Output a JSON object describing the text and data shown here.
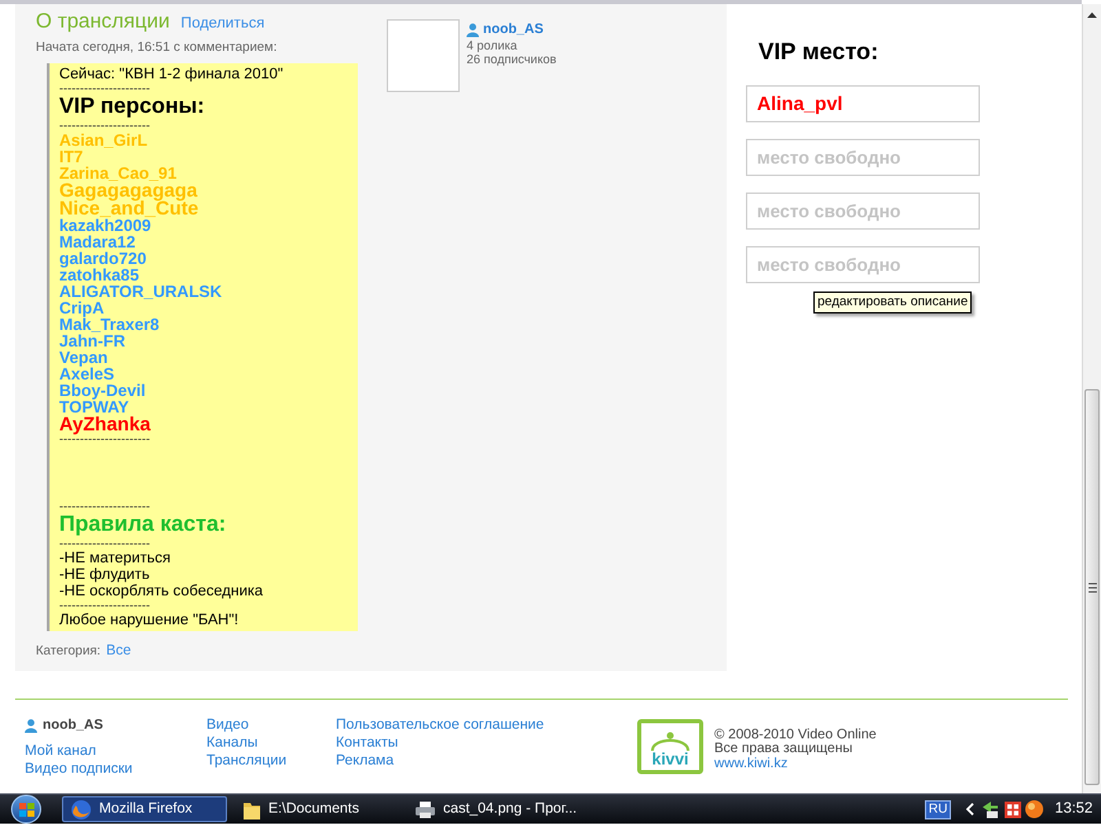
{
  "header": {
    "title": "О трансляции",
    "share_link": "Поделиться",
    "started": "Начата сегодня, 16:51 с комментарием:"
  },
  "comment": {
    "lines": [
      {
        "kind": "text",
        "text": "Сейчас: \"КВН 1-2 финала 2010\""
      },
      {
        "kind": "rule",
        "text": "----------------------"
      },
      {
        "kind": "heading",
        "text": "VIP персоны:",
        "color": "#000000"
      },
      {
        "kind": "rule",
        "text": "----------------------"
      },
      {
        "kind": "name",
        "text": "Asian_GirL",
        "color": "#ffc000"
      },
      {
        "kind": "name",
        "text": "IT7",
        "color": "#ffc000"
      },
      {
        "kind": "name",
        "text": "Zarina_Cao_91",
        "color": "#ffc000"
      },
      {
        "kind": "bigname",
        "text": "Gagagagagaga",
        "color": "#ffc000"
      },
      {
        "kind": "bigname",
        "text": "Nice_and_Cute",
        "color": "#ffc000"
      },
      {
        "kind": "name",
        "text": "kazakh2009",
        "color": "#3399ff"
      },
      {
        "kind": "name",
        "text": "Madara12",
        "color": "#3399ff"
      },
      {
        "kind": "name",
        "text": "galardo720",
        "color": "#3399ff"
      },
      {
        "kind": "name",
        "text": "zatohka85",
        "color": "#3399ff"
      },
      {
        "kind": "name",
        "text": "ALIGATOR_URALSK",
        "color": "#3399ff"
      },
      {
        "kind": "name",
        "text": "CripA",
        "color": "#3399ff"
      },
      {
        "kind": "name",
        "text": "Mak_Traxer8",
        "color": "#3399ff"
      },
      {
        "kind": "name",
        "text": "Jahn-FR",
        "color": "#3399ff"
      },
      {
        "kind": "name",
        "text": "Vepan",
        "color": "#3399ff"
      },
      {
        "kind": "name",
        "text": "AxeleS",
        "color": "#3399ff"
      },
      {
        "kind": "name",
        "text": "Bboy-Devil",
        "color": "#3399ff"
      },
      {
        "kind": "name",
        "text": "TOPWAY",
        "color": "#3399ff"
      },
      {
        "kind": "bigname",
        "text": "AyZhanka",
        "color": "#ff0000"
      },
      {
        "kind": "rule",
        "text": "----------------------"
      },
      {
        "kind": "gap"
      },
      {
        "kind": "rule",
        "text": "----------------------"
      },
      {
        "kind": "heading",
        "text": "Правила каста:",
        "color": "#1fbf2f"
      },
      {
        "kind": "rule",
        "text": "----------------------"
      },
      {
        "kind": "text",
        "text": "-НЕ материться"
      },
      {
        "kind": "text",
        "text": "-НЕ флудить"
      },
      {
        "kind": "text",
        "text": "-НЕ оскорблять собеседника"
      },
      {
        "kind": "rule",
        "text": "----------------------"
      },
      {
        "kind": "text",
        "text": "Любое нарушение \"БАН\"!"
      }
    ]
  },
  "category": {
    "label": "Категория:",
    "value": "Все"
  },
  "author": {
    "name": "noob_AS",
    "videos": "4 ролика",
    "subscribers": "26 подписчиков"
  },
  "vip": {
    "title": "VIP место:",
    "slots": [
      {
        "text": "Alina_pvl",
        "occupied": true
      },
      {
        "text": "место свободно",
        "occupied": false
      },
      {
        "text": "место свободно",
        "occupied": false
      },
      {
        "text": "место свободно",
        "occupied": false
      }
    ]
  },
  "tooltip": {
    "text": "редактировать описание"
  },
  "footer": {
    "user": "noob_AS",
    "user_links": [
      "Мой канал",
      "Видео подписки"
    ],
    "nav_links": [
      "Видео",
      "Каналы",
      "Трансляции"
    ],
    "info_links": [
      "Пользовательское соглашение",
      "Контакты",
      "Реклама"
    ],
    "logo_text": "kivvi",
    "copyright": "© 2008-2010 Video Online",
    "rights": "Все права защищены",
    "site": "www.kiwi.kz"
  },
  "taskbar": {
    "tasks": [
      {
        "label": "Mozilla Firefox",
        "selected": true,
        "kind": "browser"
      },
      {
        "label": "E:\\Documents",
        "selected": false,
        "kind": "folder"
      },
      {
        "label": "cast_04.png - Прог...",
        "selected": false,
        "kind": "viewer"
      }
    ],
    "language": "RU",
    "clock": "13:52"
  }
}
